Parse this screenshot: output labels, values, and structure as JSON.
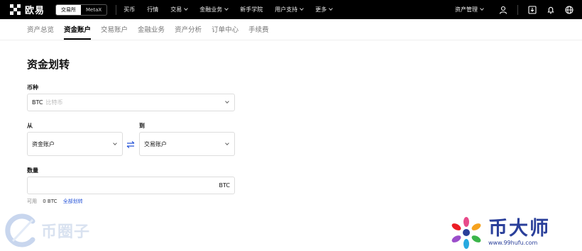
{
  "brand": {
    "name": "欧易"
  },
  "mode_switch": {
    "active": "交易所",
    "inactive": "MetaX"
  },
  "topnav": {
    "items": [
      {
        "label": "买币",
        "dropdown": false
      },
      {
        "label": "行情",
        "dropdown": false
      },
      {
        "label": "交易",
        "dropdown": true
      },
      {
        "label": "金融业务",
        "dropdown": true
      },
      {
        "label": "新手学院",
        "dropdown": false
      },
      {
        "label": "用户支持",
        "dropdown": true
      },
      {
        "label": "更多",
        "dropdown": true
      }
    ],
    "asset_menu": "资产管理",
    "icons": [
      "user-icon",
      "download-icon",
      "bell-icon",
      "globe-icon"
    ]
  },
  "subnav": {
    "tabs": [
      {
        "label": "资产总览",
        "active": false
      },
      {
        "label": "资金账户",
        "active": true
      },
      {
        "label": "交易账户",
        "active": false
      },
      {
        "label": "金融业务",
        "active": false
      },
      {
        "label": "资产分析",
        "active": false
      },
      {
        "label": "订单中心",
        "active": false
      },
      {
        "label": "手续费",
        "active": false
      }
    ]
  },
  "transfer": {
    "title": "资金划转",
    "currency_label": "币种",
    "currency_code": "BTC",
    "currency_name": "比特币",
    "from_label": "从",
    "from_value": "资金账户",
    "to_label": "到",
    "to_value": "交易账户",
    "amount_label": "数量",
    "amount_value": "",
    "amount_unit": "BTC",
    "available_label": "可用",
    "available_value": "0 BTC",
    "transfer_all": "全部划转"
  },
  "watermarks": {
    "left": "币圈子",
    "right": "币大师",
    "right_url": "www.99hufu.com"
  },
  "colors": {
    "accent": "#2855d8",
    "navbar": "#000000",
    "watermark_blue": "#2a3f9a"
  }
}
